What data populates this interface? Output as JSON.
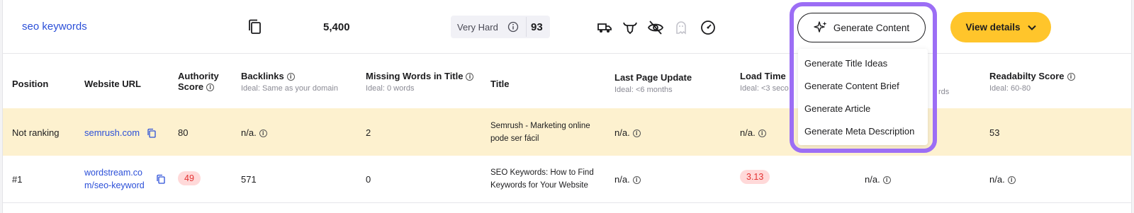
{
  "keyword": {
    "text": "seo keywords",
    "volume": "5,400",
    "difficulty_label": "Very Hard",
    "difficulty_score": "93"
  },
  "serp_features": [
    "truck-icon",
    "bull-icon",
    "eye-off-icon",
    "ghost-icon",
    "speedometer-icon"
  ],
  "buttons": {
    "generate_content": "Generate Content",
    "view_details": "View details"
  },
  "dropdown": {
    "items": [
      "Generate Title Ideas",
      "Generate Content Brief",
      "Generate Article",
      "Generate Meta Description"
    ]
  },
  "columns": {
    "position": "Position",
    "website_url": "Website URL",
    "authority_score": "Authority Score",
    "backlinks": "Backlinks",
    "backlinks_sub": "Ideal: Same as your domain",
    "missing_words": "Missing Words in Title",
    "missing_words_sub": "Ideal: 0 words",
    "title": "Title",
    "last_update": "Last Page Update",
    "last_update_sub": "Ideal: <6 months",
    "load_time": "Load Time",
    "load_time_sub": "Ideal: <3 seco",
    "hidden_sub": "rds",
    "readability": "Readabilty Score",
    "readability_sub": "Ideal: 60-80"
  },
  "rows": [
    {
      "position": "Not ranking",
      "url": "semrush.com",
      "authority": "80",
      "backlinks": "n/a.",
      "missing_words": "2",
      "title_line1": "Semrush - Marketing online",
      "title_line2": "pode ser fácil",
      "last_update": "n/a.",
      "load_time": "n/a.",
      "readability": "53"
    },
    {
      "position": "#1",
      "url_line1": "wordstream.co",
      "url_line2": "m/seo-keyword",
      "authority": "49",
      "backlinks": "571",
      "missing_words": "0",
      "title_line1": "SEO Keywords: How to Find",
      "title_line2": "Keywords for Your Website",
      "last_update": "n/a.",
      "load_time": "3.13",
      "hidden_col": "n/a.",
      "readability": "n/a."
    }
  ],
  "colors": {
    "link": "#2b4fd8",
    "highlight_row": "#fdf1cf",
    "view_button": "#ffc52b",
    "purple_outline": "#9c6ef5",
    "red_badge_bg": "#ffd9d9",
    "red_badge_text": "#e33131"
  }
}
